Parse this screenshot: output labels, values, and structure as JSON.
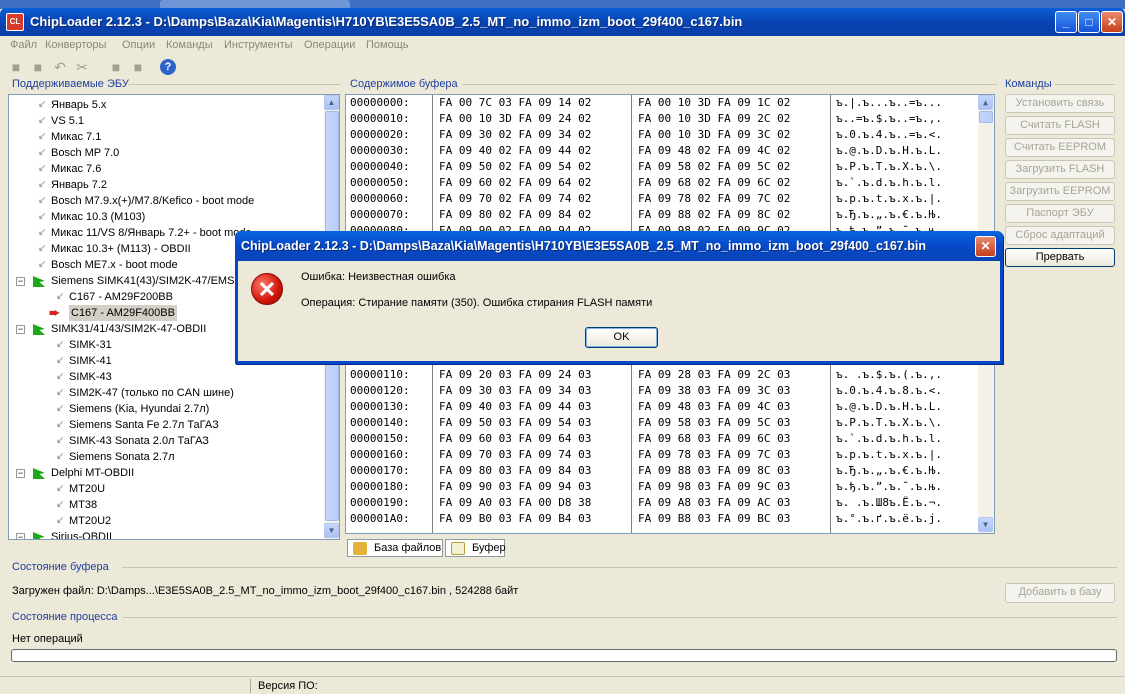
{
  "window": {
    "app_icon_text": "CL",
    "title": "ChipLoader 2.12.3 - D:\\Damps\\Baza\\Kia\\Magentis\\H710YB\\E3E5SA0B_2.5_MT_no_immo_izm_boot_29f400_c167.bin",
    "btn_min": "_",
    "btn_max": "□",
    "btn_close": "✕"
  },
  "menu": [
    "Файл",
    "Конверторы",
    "Опции",
    "Команды",
    "Инструменты",
    "Операции",
    "Помощь"
  ],
  "panels": {
    "ecu_caption": "Поддерживаемые ЭБУ",
    "buffer_caption": "Содержимое буфера",
    "commands_caption": "Команды",
    "buffer_state_caption": "Состояние буфера",
    "process_state_caption": "Состояние процесса"
  },
  "tree": [
    {
      "label": "Январь 5.x",
      "level": 1,
      "kind": "leaf"
    },
    {
      "label": "VS 5.1",
      "level": 1,
      "kind": "leaf"
    },
    {
      "label": "Микас 7.1",
      "level": 1,
      "kind": "leaf"
    },
    {
      "label": "Bosch MP 7.0",
      "level": 1,
      "kind": "leaf"
    },
    {
      "label": "Микас 7.6",
      "level": 1,
      "kind": "leaf"
    },
    {
      "label": "Январь 7.2",
      "level": 1,
      "kind": "leaf"
    },
    {
      "label": "Bosch M7.9.x(+)/M7.8/Kefico - boot mode",
      "level": 1,
      "kind": "leaf"
    },
    {
      "label": "Микас 10.3 (M103)",
      "level": 1,
      "kind": "leaf"
    },
    {
      "label": "Микас 11/VS 8/Январь 7.2+ - boot mode",
      "level": 1,
      "kind": "leaf"
    },
    {
      "label": "Микас 10.3+ (M113) - OBDII",
      "level": 1,
      "kind": "leaf"
    },
    {
      "label": "Bosch ME7.x - boot mode",
      "level": 1,
      "kind": "leaf"
    },
    {
      "label": "Siemens SIMK41(43)/SIM2K-47/EMS 3",
      "level": 0,
      "kind": "group"
    },
    {
      "label": "C167 - AM29F200BB",
      "level": 2,
      "kind": "leaf"
    },
    {
      "label": "C167 - AM29F400BB",
      "level": 2,
      "kind": "selected"
    },
    {
      "label": "SIMK31/41/43/SIM2K-47-OBDII",
      "level": 0,
      "kind": "group"
    },
    {
      "label": "SIMK-31",
      "level": 2,
      "kind": "leaf"
    },
    {
      "label": "SIMK-41",
      "level": 2,
      "kind": "leaf"
    },
    {
      "label": "SIMK-43",
      "level": 2,
      "kind": "leaf"
    },
    {
      "label": "SIM2K-47 (только по CAN шине)",
      "level": 2,
      "kind": "leaf"
    },
    {
      "label": "Siemens (Kia, Hyundai 2.7л)",
      "level": 2,
      "kind": "leaf"
    },
    {
      "label": "Siemens Santa Fe 2.7л ТаГАЗ",
      "level": 2,
      "kind": "leaf"
    },
    {
      "label": "SIMK-43 Sonata 2.0л ТаГАЗ",
      "level": 2,
      "kind": "leaf"
    },
    {
      "label": "Siemens Sonata 2.7л",
      "level": 2,
      "kind": "leaf"
    },
    {
      "label": "Delphi MT-OBDII",
      "level": 0,
      "kind": "group"
    },
    {
      "label": "MT20U",
      "level": 2,
      "kind": "leaf"
    },
    {
      "label": "MT38",
      "level": 2,
      "kind": "leaf"
    },
    {
      "label": "MT20U2",
      "level": 2,
      "kind": "leaf"
    },
    {
      "label": "Sirius-OBDII",
      "level": 0,
      "kind": "group"
    }
  ],
  "hex_top": [
    {
      "addr": "00000000:",
      "a": "FA 00 7C 03 FA 09 14 02",
      "b": "FA 00 10 3D FA 09 1C 02",
      "ascii": "ъ.|.ъ...ъ..=ъ..."
    },
    {
      "addr": "00000010:",
      "a": "FA 00 10 3D FA 09 24 02",
      "b": "FA 00 10 3D FA 09 2C 02",
      "ascii": "ъ..=ъ.$.ъ..=ъ.,."
    },
    {
      "addr": "00000020:",
      "a": "FA 09 30 02 FA 09 34 02",
      "b": "FA 00 10 3D FA 09 3C 02",
      "ascii": "ъ.0.ъ.4.ъ..=ъ.<."
    },
    {
      "addr": "00000030:",
      "a": "FA 09 40 02 FA 09 44 02",
      "b": "FA 09 48 02 FA 09 4C 02",
      "ascii": "ъ.@.ъ.D.ъ.H.ъ.L."
    },
    {
      "addr": "00000040:",
      "a": "FA 09 50 02 FA 09 54 02",
      "b": "FA 09 58 02 FA 09 5C 02",
      "ascii": "ъ.P.ъ.T.ъ.X.ъ.\\."
    },
    {
      "addr": "00000050:",
      "a": "FA 09 60 02 FA 09 64 02",
      "b": "FA 09 68 02 FA 09 6C 02",
      "ascii": "ъ.`.ъ.d.ъ.h.ъ.l."
    },
    {
      "addr": "00000060:",
      "a": "FA 09 70 02 FA 09 74 02",
      "b": "FA 09 78 02 FA 09 7C 02",
      "ascii": "ъ.p.ъ.t.ъ.x.ъ.|."
    },
    {
      "addr": "00000070:",
      "a": "FA 09 80 02 FA 09 84 02",
      "b": "FA 09 88 02 FA 09 8C 02",
      "ascii": "ъ.Ђ.ъ.„.ъ.€.ъ.Њ."
    },
    {
      "addr": "00000080:",
      "a": "FA 09 90 02 FA 09 94 02",
      "b": "FA 09 98 02 FA 09 9C 02",
      "ascii": "ъ.ђ.ъ.”.ъ.˜.ъ.њ."
    }
  ],
  "hex_bottom": [
    {
      "addr": "00000110:",
      "a": "FA 09 20 03 FA 09 24 03",
      "b": "FA 09 28 03 FA 09 2C 03",
      "ascii": "ъ. .ъ.$.ъ.(.ъ.,."
    },
    {
      "addr": "00000120:",
      "a": "FA 09 30 03 FA 09 34 03",
      "b": "FA 09 38 03 FA 09 3C 03",
      "ascii": "ъ.0.ъ.4.ъ.8.ъ.<."
    },
    {
      "addr": "00000130:",
      "a": "FA 09 40 03 FA 09 44 03",
      "b": "FA 09 48 03 FA 09 4C 03",
      "ascii": "ъ.@.ъ.D.ъ.H.ъ.L."
    },
    {
      "addr": "00000140:",
      "a": "FA 09 50 03 FA 09 54 03",
      "b": "FA 09 58 03 FA 09 5C 03",
      "ascii": "ъ.P.ъ.T.ъ.X.ъ.\\."
    },
    {
      "addr": "00000150:",
      "a": "FA 09 60 03 FA 09 64 03",
      "b": "FA 09 68 03 FA 09 6C 03",
      "ascii": "ъ.`.ъ.d.ъ.h.ъ.l."
    },
    {
      "addr": "00000160:",
      "a": "FA 09 70 03 FA 09 74 03",
      "b": "FA 09 78 03 FA 09 7C 03",
      "ascii": "ъ.p.ъ.t.ъ.x.ъ.|."
    },
    {
      "addr": "00000170:",
      "a": "FA 09 80 03 FA 09 84 03",
      "b": "FA 09 88 03 FA 09 8C 03",
      "ascii": "ъ.Ђ.ъ.„.ъ.€.ъ.Њ."
    },
    {
      "addr": "00000180:",
      "a": "FA 09 90 03 FA 09 94 03",
      "b": "FA 09 98 03 FA 09 9C 03",
      "ascii": "ъ.ђ.ъ.”.ъ.˜.ъ.њ."
    },
    {
      "addr": "00000190:",
      "a": "FA 09 A0 03 FA 00 D8 38",
      "b": "FA 09 A8 03 FA 09 AC 03",
      "ascii": "ъ. .ъ.Ш8ъ.Ё.ъ.¬."
    },
    {
      "addr": "000001A0:",
      "a": "FA 09 B0 03 FA 09 B4 03",
      "b": "FA 09 B8 03 FA 09 BC 03",
      "ascii": "ъ.°.ъ.ґ.ъ.ё.ъ.ј."
    }
  ],
  "hex_tabs": [
    "База файлов",
    "Буфер"
  ],
  "commands": [
    {
      "label": "Установить связь",
      "enabled": false
    },
    {
      "label": "Считать FLASH",
      "enabled": false
    },
    {
      "label": "Считать EEPROM",
      "enabled": false
    },
    {
      "label": "Загрузить FLASH",
      "enabled": false
    },
    {
      "label": "Загрузить EEPROM",
      "enabled": false
    },
    {
      "label": "Паспорт ЭБУ",
      "enabled": false
    },
    {
      "label": "Сброс адаптаций",
      "enabled": false
    },
    {
      "label": "Прервать",
      "enabled": true
    }
  ],
  "buffer_status": {
    "loaded_text": "Загружен файл: D:\\Damps...\\E3E5SA0B_2.5_MT_no_immo_izm_boot_29f400_c167.bin , 524288 байт",
    "add_to_base_label": "Добавить в базу"
  },
  "process_status": {
    "text": "Нет операций",
    "progress": 0
  },
  "statusbar": {
    "version_label": "Версия ПО:"
  },
  "dialog": {
    "title": "ChipLoader 2.12.3 - D:\\Damps\\Baza\\Kia\\Magentis\\H710YB\\E3E5SA0B_2.5_MT_no_immo_izm_boot_29f400_c167.bin",
    "message1": "Ошибка: Неизвестная ошибка",
    "message2": "Операция: Стирание памяти (350). Ошибка стирания FLASH памяти",
    "ok_label": "OK",
    "close_glyph": "✕",
    "error_glyph": "✕"
  },
  "colors": {
    "accent_title": "#0846c8",
    "caption_text": "#1f3f9f",
    "error_red": "#d0140a",
    "tree_group_icon": "#1ba81b"
  }
}
